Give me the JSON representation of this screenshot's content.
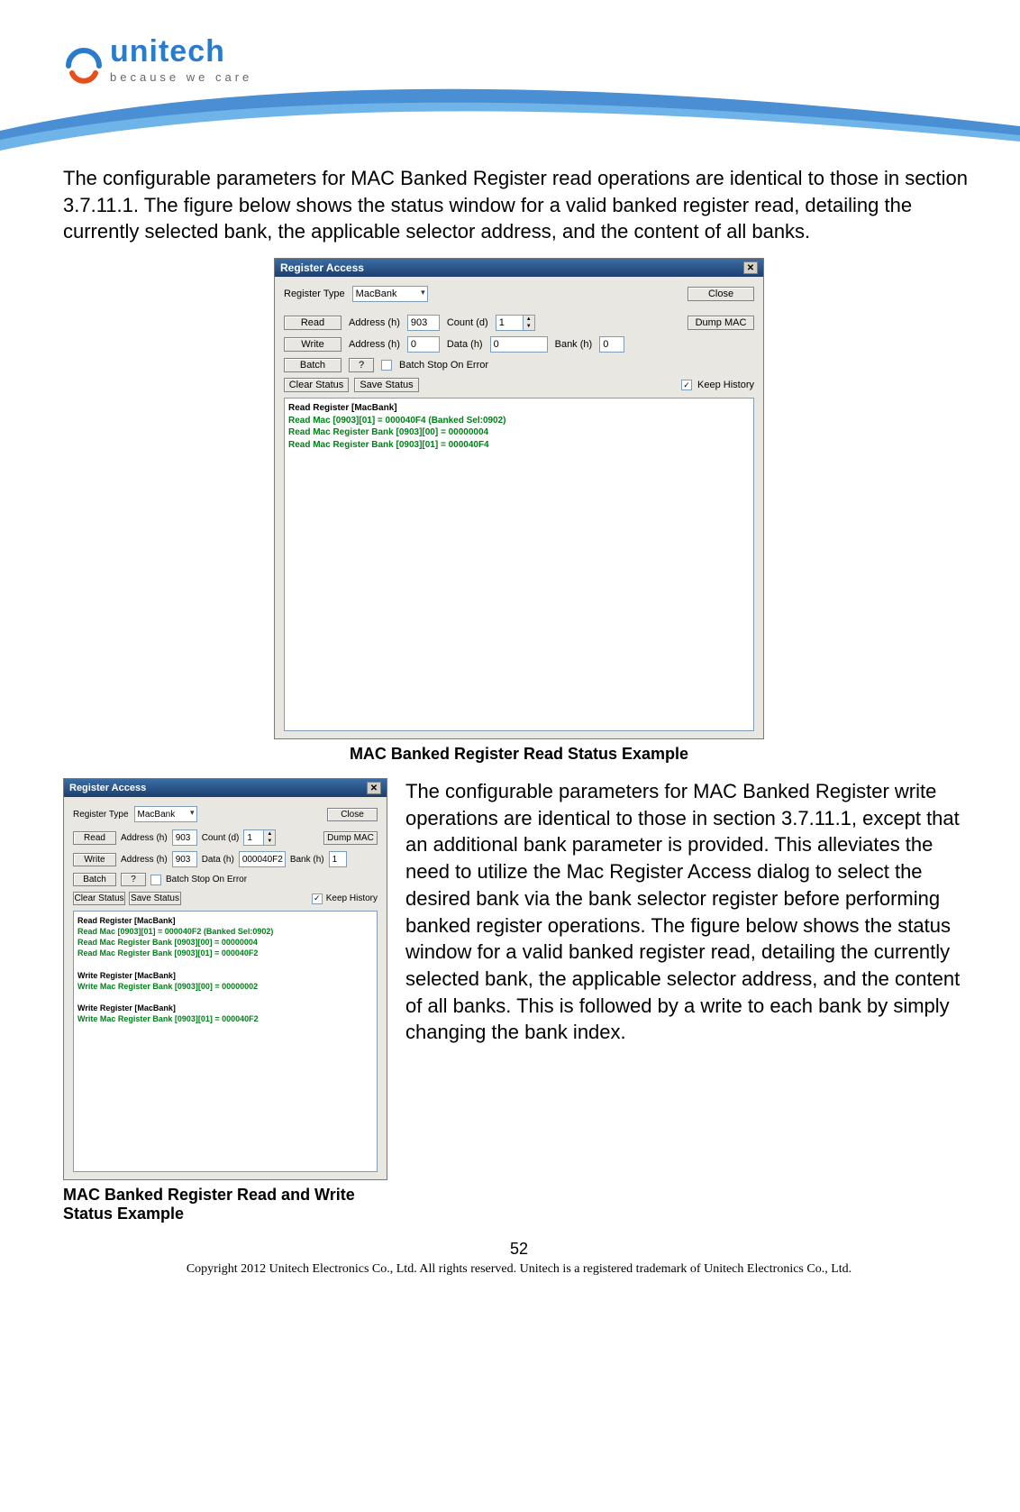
{
  "brand": {
    "name": "unitech",
    "tagline": "because we care"
  },
  "para1": "The configurable parameters for MAC Banked Register read operations are identical to those in section 3.7.11.1. The figure below shows the status window for a valid banked register read, detailing the currently selected bank, the applicable selector address, and the content of all banks.",
  "dialog1": {
    "title": "Register Access",
    "registerType_label": "Register Type",
    "registerType_value": "MacBank",
    "close": "Close",
    "read": "Read",
    "write": "Write",
    "batch": "Batch",
    "q": "?",
    "address_label": "Address (h)",
    "count_label": "Count (d)",
    "data_label": "Data (h)",
    "bank_label": "Bank (h)",
    "dump": "Dump MAC",
    "addr_read": "903",
    "count": "1",
    "addr_write": "0",
    "data": "0",
    "bank": "0",
    "batchStop": "Batch Stop On Error",
    "clearStatus": "Clear Status",
    "saveStatus": "Save Status",
    "keepHistory": "Keep History",
    "status_header": "Read Register [MacBank]",
    "status_l1": "Read Mac [0903][01] = 000040F4 (Banked Sel:0902)",
    "status_l2": "Read Mac Register Bank [0903][00] = 00000004",
    "status_l3": "Read Mac Register Bank [0903][01] = 000040F4"
  },
  "caption1": "MAC Banked Register Read Status Example",
  "dialog2": {
    "title": "Register Access",
    "registerType_label": "Register Type",
    "registerType_value": "MacBank",
    "close": "Close",
    "read": "Read",
    "write": "Write",
    "batch": "Batch",
    "q": "?",
    "address_label": "Address (h)",
    "count_label": "Count (d)",
    "data_label": "Data (h)",
    "bank_label": "Bank (h)",
    "dump": "Dump MAC",
    "addr_read": "903",
    "count": "1",
    "addr_write": "903",
    "data": "000040F2",
    "bank": "1",
    "batchStop": "Batch Stop On Error",
    "clearStatus": "Clear Status",
    "saveStatus": "Save Status",
    "keepHistory": "Keep History",
    "s_h1": "Read Register [MacBank]",
    "s_l1": "Read Mac [0903][01] = 000040F2 (Banked Sel:0902)",
    "s_l2": "Read Mac Register Bank [0903][00] = 00000004",
    "s_l3": "Read Mac Register Bank [0903][01] = 000040F2",
    "s_h2": "Write Register [MacBank]",
    "s_l4": "Write Mac Register Bank [0903][00] = 00000002",
    "s_h3": "Write Register [MacBank]",
    "s_l5": "Write Mac Register Bank [0903][01] = 000040F2"
  },
  "para2": "The configurable parameters for MAC Banked Register write operations are identical to those in section 3.7.11.1, except that an additional bank parameter is provided. This alleviates the need to utilize the Mac Register Access dialog to select the desired bank via the bank selector register before performing banked register operations. The figure below shows the status window for a valid banked register read, detailing the currently selected bank, the applicable selector address, and the content of all banks. This is followed by a write to each bank by simply changing the bank index.",
  "caption2": "MAC Banked Register Read and Write Status Example",
  "page_number": "52",
  "copyright": "Copyright 2012 Unitech Electronics Co., Ltd. All rights reserved. Unitech is a registered trademark of Unitech Electronics Co., Ltd."
}
